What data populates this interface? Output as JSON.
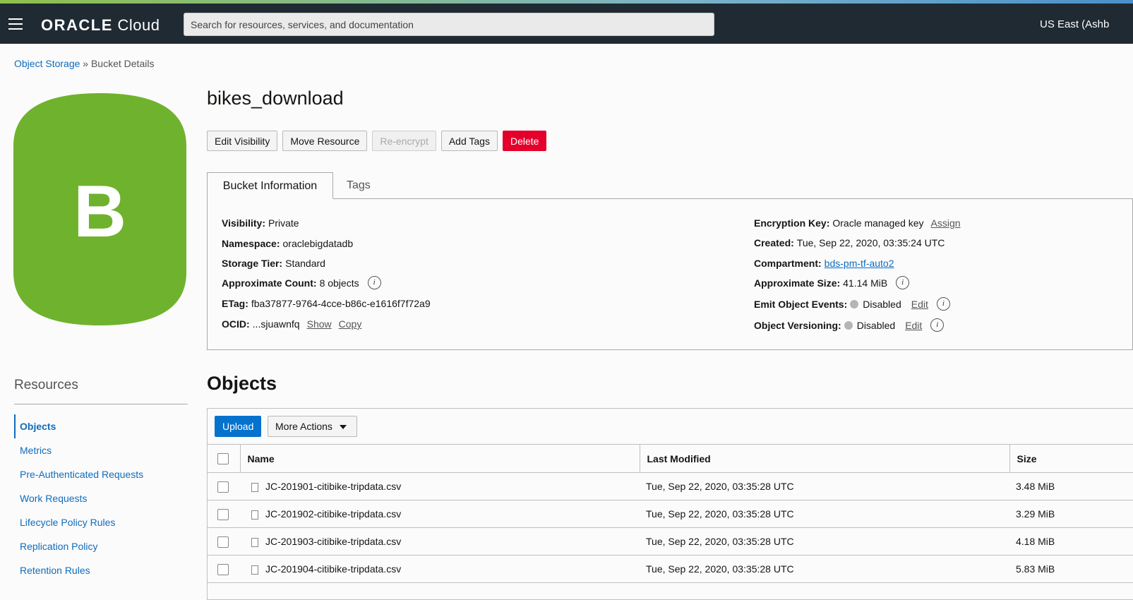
{
  "header": {
    "logo_brand": "ORACLE",
    "logo_product": "Cloud",
    "search_placeholder": "Search for resources, services, and documentation",
    "region": "US East (Ashb"
  },
  "breadcrumb": {
    "parent": "Object Storage",
    "separator": " » ",
    "current": "Bucket Details"
  },
  "bucket_icon": {
    "letter": "B",
    "color": "#6fb22e"
  },
  "bucket": {
    "title": "bikes_download",
    "actions": [
      "Edit Visibility",
      "Move Resource",
      "Re-encrypt",
      "Add Tags",
      "Delete"
    ]
  },
  "tabs": [
    "Bucket Information",
    "Tags"
  ],
  "info_left": [
    {
      "label": "Visibility:",
      "value": "Private"
    },
    {
      "label": "Namespace:",
      "value": "oraclebigdatadb"
    },
    {
      "label": "Storage Tier:",
      "value": "Standard"
    },
    {
      "label": "Approximate Count:",
      "value": "8 objects"
    },
    {
      "label": "ETag:",
      "value": "fba37877-9764-4cce-b86c-e1616f7f72a9"
    },
    {
      "label": "OCID:",
      "value": "...sjuawnfq",
      "link1": "Show",
      "link2": "Copy"
    }
  ],
  "info_right": [
    {
      "label": "Encryption Key:",
      "value": "Oracle managed key",
      "link": "Assign"
    },
    {
      "label": "Created:",
      "value": "Tue, Sep 22, 2020, 03:35:24 UTC"
    },
    {
      "label": "Compartment:",
      "value": "bds-pm-tf-auto2"
    },
    {
      "label": "Approximate Size:",
      "value": "41.14 MiB"
    },
    {
      "label": "Emit Object Events:",
      "value": "Disabled",
      "link": "Edit"
    },
    {
      "label": "Object Versioning:",
      "value": "Disabled",
      "link": "Edit"
    }
  ],
  "info_icon_glyph": "i",
  "resources": {
    "title": "Resources",
    "items": [
      "Objects",
      "Metrics",
      "Pre-Authenticated Requests",
      "Work Requests",
      "Lifecycle Policy Rules",
      "Replication Policy",
      "Retention Rules"
    ]
  },
  "objects": {
    "title": "Objects",
    "upload_label": "Upload",
    "more_actions_label": "More Actions",
    "columns": [
      "Name",
      "Last Modified",
      "Size"
    ],
    "rows": [
      {
        "name": "JC-201901-citibike-tripdata.csv",
        "modified": "Tue, Sep 22, 2020, 03:35:28 UTC",
        "size": "3.48 MiB"
      },
      {
        "name": "JC-201902-citibike-tripdata.csv",
        "modified": "Tue, Sep 22, 2020, 03:35:28 UTC",
        "size": "3.29 MiB"
      },
      {
        "name": "JC-201903-citibike-tripdata.csv",
        "modified": "Tue, Sep 22, 2020, 03:35:28 UTC",
        "size": "4.18 MiB"
      },
      {
        "name": "JC-201904-citibike-tripdata.csv",
        "modified": "Tue, Sep 22, 2020, 03:35:28 UTC",
        "size": "5.83 MiB"
      }
    ]
  },
  "colors": {
    "topbar": "#1f2a33",
    "link": "#0f6cbd",
    "primary_button": "#0572ce",
    "danger_button": "#e4002b",
    "bucket_green": "#6fb22e"
  }
}
